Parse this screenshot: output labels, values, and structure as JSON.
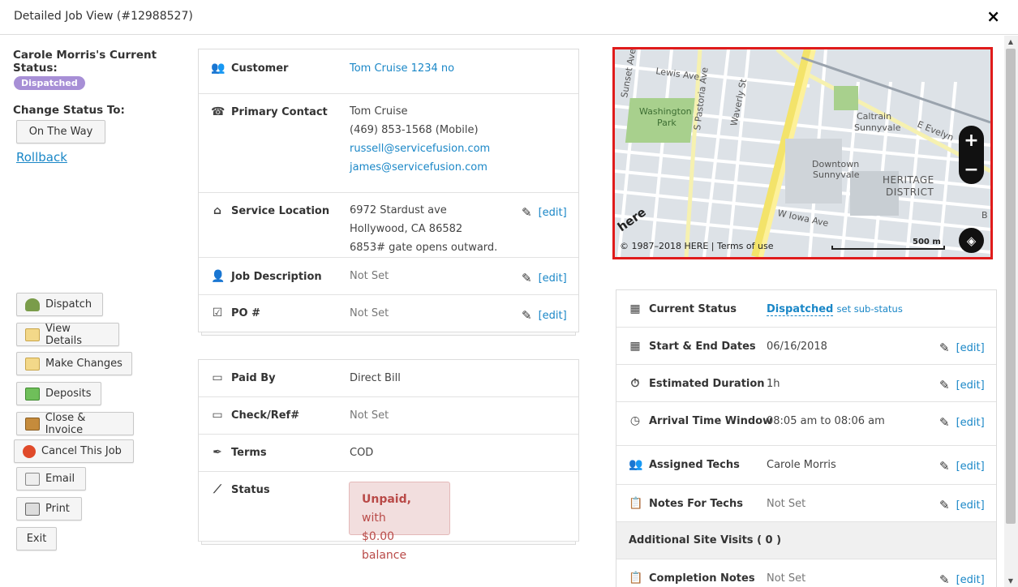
{
  "window": {
    "title": "Detailed Job View (#12988527)",
    "close_glyph": "×"
  },
  "left": {
    "status_heading": "Carole Morris's Current Status:",
    "status_badge": "Dispatched",
    "change_status_label": "Change Status To:",
    "change_status_button": "On The Way",
    "rollback_link": "Rollback",
    "actions": {
      "dispatch": "Dispatch",
      "view_details": "View Details",
      "make_changes": "Make Changes",
      "deposits": "Deposits",
      "close_invoice": "Close & Invoice",
      "cancel_job": "Cancel This Job",
      "email": "Email",
      "print": "Print",
      "exit": "Exit"
    }
  },
  "job": {
    "customer_label": "Customer",
    "customer_value": "Tom Cruise 1234 no",
    "primary_contact_label": "Primary Contact",
    "contact_name": "Tom Cruise",
    "contact_phone": "(469) 853-1568 (Mobile)",
    "contact_email_1": "russell@servicefusion.com",
    "contact_email_2": "james@servicefusion.com",
    "service_location_label": "Service Location",
    "location_line_1": "6972 Stardust ave",
    "location_line_2": "Hollywood, CA 86582",
    "location_line_3": "6853# gate opens outward.",
    "job_description_label": "Job Description",
    "job_description_value": "Not Set",
    "po_label": "PO #",
    "po_value": "Not Set",
    "edit_label": "[edit]"
  },
  "payment": {
    "paid_by_label": "Paid By",
    "paid_by_value": "Direct Bill",
    "check_ref_label": "Check/Ref#",
    "check_ref_value": "Not Set",
    "terms_label": "Terms",
    "terms_value": "COD",
    "status_label": "Status",
    "status_strong": "Unpaid,",
    "status_rest_1": " with",
    "status_rest_2": "$0.00 balance"
  },
  "map": {
    "labels": {
      "sunset": "Sunset Ave",
      "lewis": "Lewis Ave",
      "pastoria": "S Pastoria Ave",
      "waverly": "Waverly St",
      "washington_1": "Washington",
      "washington_2": "Park",
      "caltrain_1": "Caltrain",
      "caltrain_2": "Sunnyvale",
      "evelyn": "E Evelyn",
      "downtown_1": "Downtown",
      "downtown_2": "Sunnyvale",
      "heritage_1": "HERITAGE",
      "heritage_2": "DISTRICT",
      "iowa": "W Iowa Ave",
      "here": "here",
      "b": "B"
    },
    "copyright": "© 1987–2018 HERE | ",
    "terms": "Terms of use",
    "scale": "500 m",
    "zoom_in": "+",
    "zoom_out": "−",
    "layers_glyph": "◈"
  },
  "details": {
    "current_status_label": "Current Status",
    "current_status_value": "Dispatched",
    "sub_status_link": "set sub-status",
    "dates_label": "Start & End Dates",
    "dates_value": "06/16/2018",
    "duration_label": "Estimated Duration",
    "duration_value": "1h",
    "arrival_label": "Arrival Time Window",
    "arrival_value": "08:05 am to 08:06 am",
    "techs_label": "Assigned Techs",
    "techs_value": "Carole Morris",
    "notes_label": "Notes For Techs",
    "notes_value": "Not Set",
    "site_visits_label": "Additional Site Visits ( 0 )",
    "completion_label": "Completion Notes",
    "completion_value": "Not Set",
    "edit_label": "[edit]"
  },
  "colors": {
    "accent_link": "#1a87c7",
    "badge": "#a78fd6",
    "unpaid_bg": "#f2dede",
    "unpaid_text": "#b94a48",
    "map_border": "#e01b1b"
  }
}
